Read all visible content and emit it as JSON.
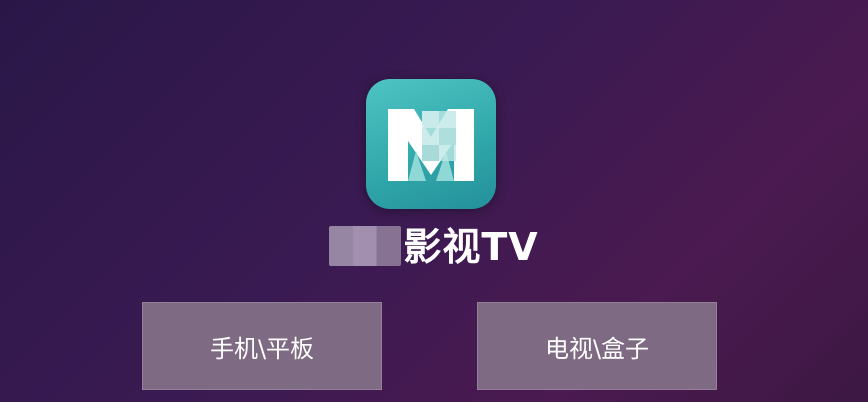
{
  "app": {
    "title_visible": "影视TV",
    "icon_name": "app-logo-m-icon"
  },
  "buttons": {
    "phone_tablet": "手机\\平板",
    "tv_box": "电视\\盒子"
  },
  "colors": {
    "background": "#3a1a52",
    "icon_teal": "#2fa6a9",
    "button": "#7e6a82"
  }
}
